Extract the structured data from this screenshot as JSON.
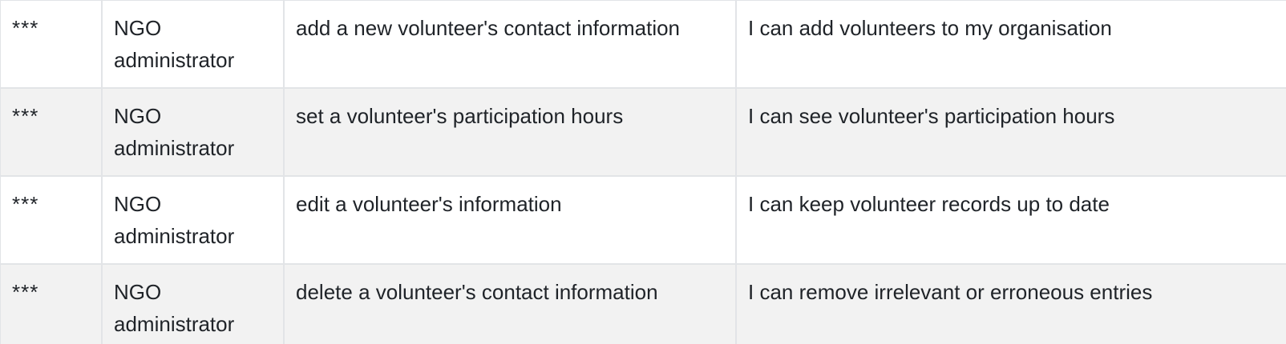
{
  "rows": [
    {
      "priority": "***",
      "as_a": "NGO administrator",
      "i_want_to": "add a new volunteer's contact information",
      "so_that": "I can add volunteers to my organisation"
    },
    {
      "priority": "***",
      "as_a": "NGO administrator",
      "i_want_to": "set a volunteer's participation hours",
      "so_that": "I can see volunteer's participation hours"
    },
    {
      "priority": "***",
      "as_a": "NGO administrator",
      "i_want_to": "edit a volunteer's information",
      "so_that": "I can keep volunteer records up to date"
    },
    {
      "priority": "***",
      "as_a": "NGO administrator",
      "i_want_to": "delete a volunteer's contact information",
      "so_that": "I can remove irrelevant or erroneous entries"
    }
  ]
}
